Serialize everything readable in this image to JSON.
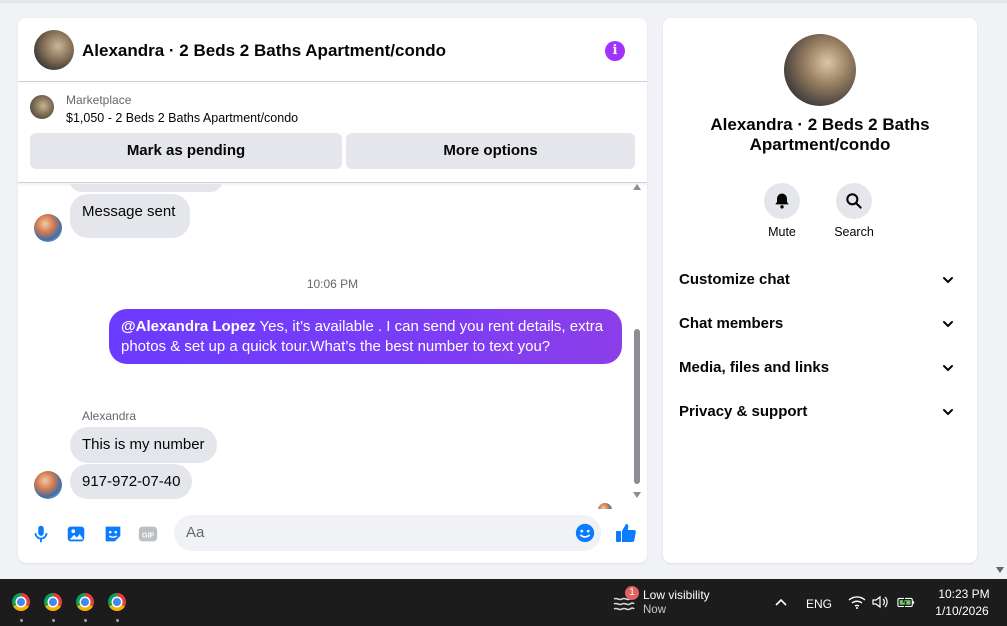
{
  "chat": {
    "title": "Alexandra · 2 Beds 2 Baths Apartment/condo",
    "info_icon": "info-icon"
  },
  "listing": {
    "kicker": "Marketplace",
    "title": "$1,050 - 2 Beds 2 Baths Apartment/condo",
    "mark_pending_label": "Mark as pending",
    "more_options_label": "More options"
  },
  "messages": {
    "first_incoming": "Message sent",
    "timestamp": "10:06 PM",
    "outgoing_mention": "@Alexandra Lopez",
    "outgoing_text": " Yes, it’s available .  I can send you rent details, extra photos & set up a quick tour.What’s the best number to text you?",
    "sender_name": "Alexandra",
    "incoming_2": "This is my number",
    "incoming_3": "917-972-07-40"
  },
  "composer": {
    "placeholder": "Aa",
    "icons": [
      "microphone-icon",
      "photo-icon",
      "sticker-icon",
      "gif-icon",
      "emoji-icon",
      "thumbs-up-icon"
    ]
  },
  "info_panel": {
    "title": "Alexandra · 2 Beds 2 Baths Apartment/condo",
    "actions": [
      {
        "label": "Mute",
        "icon": "bell-icon"
      },
      {
        "label": "Search",
        "icon": "search-icon"
      }
    ],
    "sections": [
      {
        "label": "Customize chat"
      },
      {
        "label": "Chat members"
      },
      {
        "label": "Media, files and links"
      },
      {
        "label": "Privacy & support"
      }
    ]
  },
  "taskbar": {
    "apps": [
      "chrome-icon",
      "chrome-icon",
      "chrome-icon",
      "chrome-icon"
    ],
    "notification_count": "1",
    "weather_title": "Low visibility",
    "weather_sub": "Now",
    "language": "ENG",
    "time": "10:23 PM",
    "date": "1/10/2026"
  },
  "colors": {
    "accent_purple": "#a033ff",
    "outgoing_bubble_start": "#6b3bff",
    "outgoing_bubble_end": "#8c3ee8",
    "messenger_blue": "#0a7cff",
    "taskbar": "#1c1c1c"
  }
}
